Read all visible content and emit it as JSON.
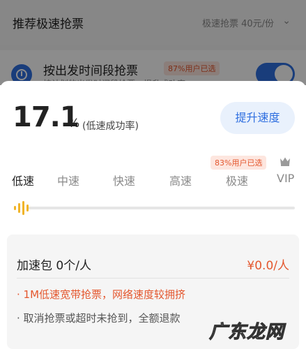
{
  "background": {
    "header_title": "推荐极速抢票",
    "price_text": "极速抢票 40元/份",
    "row_title": "按出发时间段抢票",
    "row_badge": "87%用户已选",
    "row_sub": "按计划的出发时间段抢票，提升成功率",
    "toggle_on": true
  },
  "rate": {
    "value": "17.1",
    "unit": "%",
    "label": "(低速成功率)"
  },
  "boost_button": "提升速度",
  "speed": {
    "badge": "83%用户已选",
    "tabs": [
      "低速",
      "中速",
      "快速",
      "高速",
      "极速",
      "VIP"
    ],
    "selected_index": 0,
    "selected_fraction": 0
  },
  "package": {
    "title": "加速包 0个/人",
    "price": "¥0.0/人",
    "bullets": [
      "1M低速宽带抢票，网络速度较拥挤",
      "取消抢票或超时未抢到，全额退款"
    ]
  },
  "watermark": "广东龙网",
  "colors": {
    "accent_blue": "#2f6fe0",
    "accent_orange": "#e4572e",
    "slider_gold": "#f0b429"
  }
}
